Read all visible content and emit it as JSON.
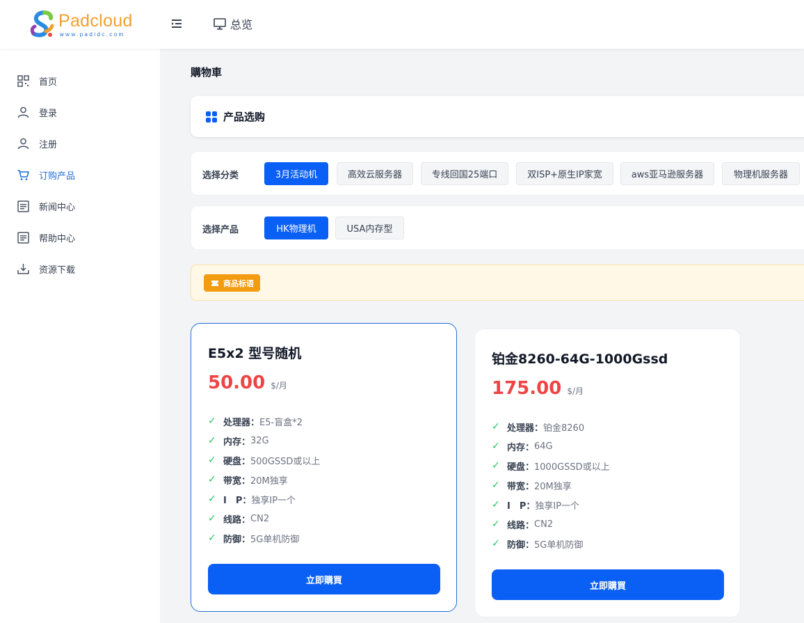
{
  "header": {
    "logo_text": "Padcloud",
    "logo_sub": "www.padidc.com",
    "overview_label": "总览"
  },
  "sidebar": {
    "items": [
      {
        "label": "首页",
        "icon": "grid-qr-icon"
      },
      {
        "label": "登录",
        "icon": "user-icon"
      },
      {
        "label": "注册",
        "icon": "user-icon"
      },
      {
        "label": "订购产品",
        "icon": "cart-icon",
        "active": true
      },
      {
        "label": "新闻中心",
        "icon": "document-icon"
      },
      {
        "label": "帮助中心",
        "icon": "document-icon"
      },
      {
        "label": "资源下载",
        "icon": "download-icon"
      }
    ]
  },
  "main": {
    "page_title": "購物車",
    "section_title": "产品选购",
    "category_filter": {
      "label": "选择分类",
      "options": [
        "3月活动机",
        "高效云服务器",
        "专线回国25端口",
        "双ISP+原生IP家宽",
        "aws亚马逊服务器",
        "物理机服务器"
      ],
      "selected": "3月活动机"
    },
    "product_filter": {
      "label": "选择产品",
      "options": [
        "HK物理机",
        "USA内存型"
      ],
      "selected": "HK物理机"
    },
    "tag_label": "商品标语"
  },
  "products": [
    {
      "name": "E5x2 型号随机",
      "price": "50.00",
      "unit": "$/月",
      "specs": [
        {
          "key": "处理器：",
          "value": "E5-盲盒*2"
        },
        {
          "key": "内存：",
          "value": "32G"
        },
        {
          "key": "硬盘：",
          "value": "500GSSD或以上"
        },
        {
          "key": "带宽：",
          "value": "20M独享"
        },
        {
          "key": "I　P：",
          "value": "独享IP一个"
        },
        {
          "key": "线路：",
          "value": "CN2"
        },
        {
          "key": "防御：",
          "value": "5G单机防御"
        }
      ],
      "buy_label": "立即購買"
    },
    {
      "name": "铂金8260-64G-1000Gssd",
      "price": "175.00",
      "unit": "$/月",
      "specs": [
        {
          "key": "处理器：",
          "value": "铂金8260"
        },
        {
          "key": "内存：",
          "value": "64G"
        },
        {
          "key": "硬盘：",
          "value": "1000GSSD或以上"
        },
        {
          "key": "带宽：",
          "value": "20M独享"
        },
        {
          "key": "I　P：",
          "value": "独享IP一个"
        },
        {
          "key": "线路：",
          "value": "CN2"
        },
        {
          "key": "防御：",
          "value": "5G单机防御"
        }
      ],
      "buy_label": "立即購買"
    }
  ],
  "colors": {
    "accent": "#0a5ff5",
    "price": "#ef4444",
    "check": "#22c55e",
    "tag": "#f39c12"
  }
}
